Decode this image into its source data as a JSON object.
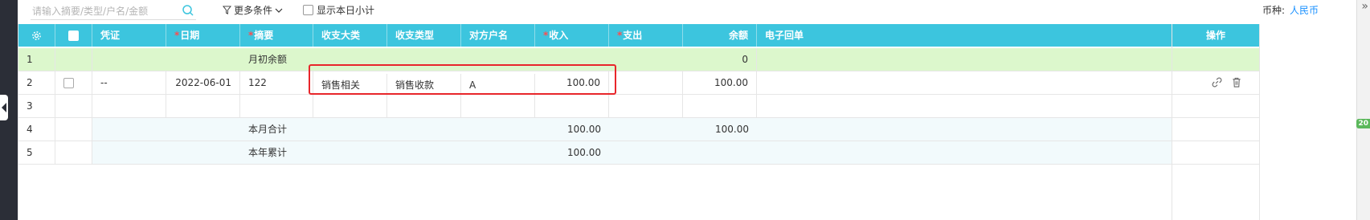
{
  "toolbar": {
    "search_placeholder": "请输入摘要/类型/户名/金额",
    "more_conditions": "更多条件",
    "show_daily_subtotal": "显示本日小计",
    "currency_label": "币种:",
    "currency_value": "人民币"
  },
  "table": {
    "columns": {
      "voucher": "凭证",
      "date": "日期",
      "summary": "摘要",
      "category": "收支大类",
      "type": "收支类型",
      "counterparty": "对方户名",
      "income": "收入",
      "expense": "支出",
      "balance": "余额",
      "receipt": "电子回单",
      "operation": "操作"
    },
    "rows": [
      {
        "index": "1",
        "summary": "月初余额",
        "balance": "0"
      },
      {
        "index": "2",
        "voucher": "--",
        "date": "2022-06-01",
        "summary": "122",
        "category": "销售相关",
        "type": "销售收款",
        "counterparty": "A",
        "income": "100.00",
        "balance": "100.00"
      },
      {
        "index": "3"
      },
      {
        "index": "4",
        "summary": "本月合计",
        "income": "100.00",
        "balance": "100.00"
      },
      {
        "index": "5",
        "summary": "本年累计",
        "income": "100.00"
      }
    ]
  },
  "side_badge": "20",
  "colors": {
    "header_bg": "#3cc5de",
    "opening_row_bg": "#dcf7cc",
    "summary_row_bg": "#f2fafc",
    "highlight_border": "#e8262b",
    "link_color": "#1890ff"
  }
}
